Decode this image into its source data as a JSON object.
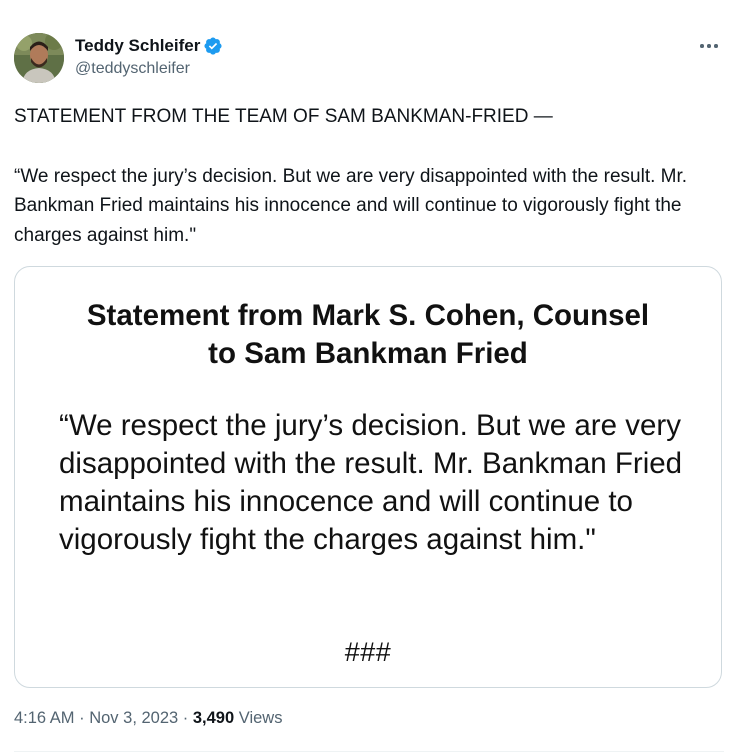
{
  "author": {
    "display_name": "Teddy Schleifer",
    "handle": "@teddyschleifer",
    "verified": true,
    "verified_color": "#1d9bf0"
  },
  "tweet": {
    "paragraphs": [
      "STATEMENT FROM THE TEAM OF SAM BANKMAN-FRIED —",
      "“We respect the jury’s decision. But we are very disappointed with the result. Mr. Bankman Fried maintains his innocence and will continue to vigorously fight the charges against him.\""
    ]
  },
  "media": {
    "title_line1": "Statement from Mark S. Cohen, Counsel",
    "title_line2": "to Sam Bankman Fried",
    "quote": "“We respect the jury’s decision. But we are very disappointed with the result. Mr. Bankman Fried maintains his innocence and will continue to vigorously fight the charges against him.\"",
    "end_mark": "###"
  },
  "meta": {
    "time": "4:16 AM",
    "separator": " · ",
    "date": "Nov 3, 2023",
    "views_count": "3,490",
    "views_label": " Views"
  },
  "icons": {
    "more": "more-horizontal-icon",
    "verified": "verified-badge-icon"
  },
  "colors": {
    "text_primary": "#0f1419",
    "text_secondary": "#536471",
    "border": "#cfd9de"
  }
}
